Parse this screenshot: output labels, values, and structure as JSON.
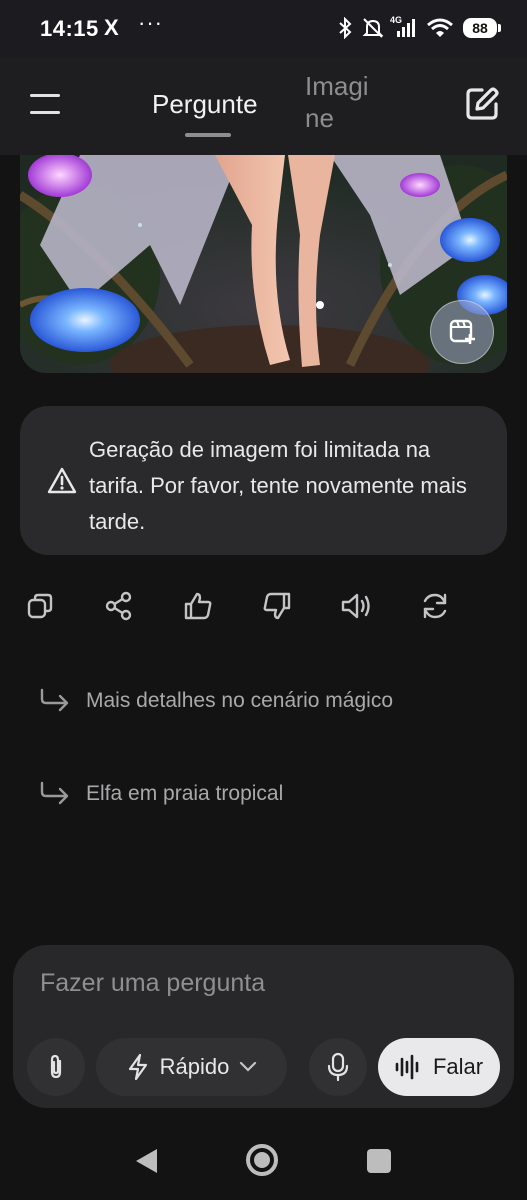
{
  "status_bar": {
    "time": "14:15",
    "app_icon": "X",
    "more": "···",
    "network": "4G",
    "battery": "88"
  },
  "header": {
    "tabs": [
      {
        "label": "Pergunte",
        "active": true
      },
      {
        "label": "Imagi ne",
        "active": false
      }
    ]
  },
  "message": {
    "warning_text": "Geração de imagem foi limitada na tarifa. Por favor, tente novamente mais tarde."
  },
  "actions": [
    "copy-icon",
    "share-icon",
    "thumbs-up-icon",
    "thumbs-down-icon",
    "speaker-icon",
    "regenerate-icon"
  ],
  "suggestions": [
    {
      "label": "Mais detalhes no cenário mágico"
    },
    {
      "label": "Elfa em praia tropical"
    }
  ],
  "composer": {
    "placeholder": "Fazer uma pergunta",
    "mode_label": "Rápido",
    "talk_label": "Falar"
  },
  "colors": {
    "background": "#131314",
    "bubble": "#2a2a2c",
    "talk_button": "#e9e9eb"
  }
}
